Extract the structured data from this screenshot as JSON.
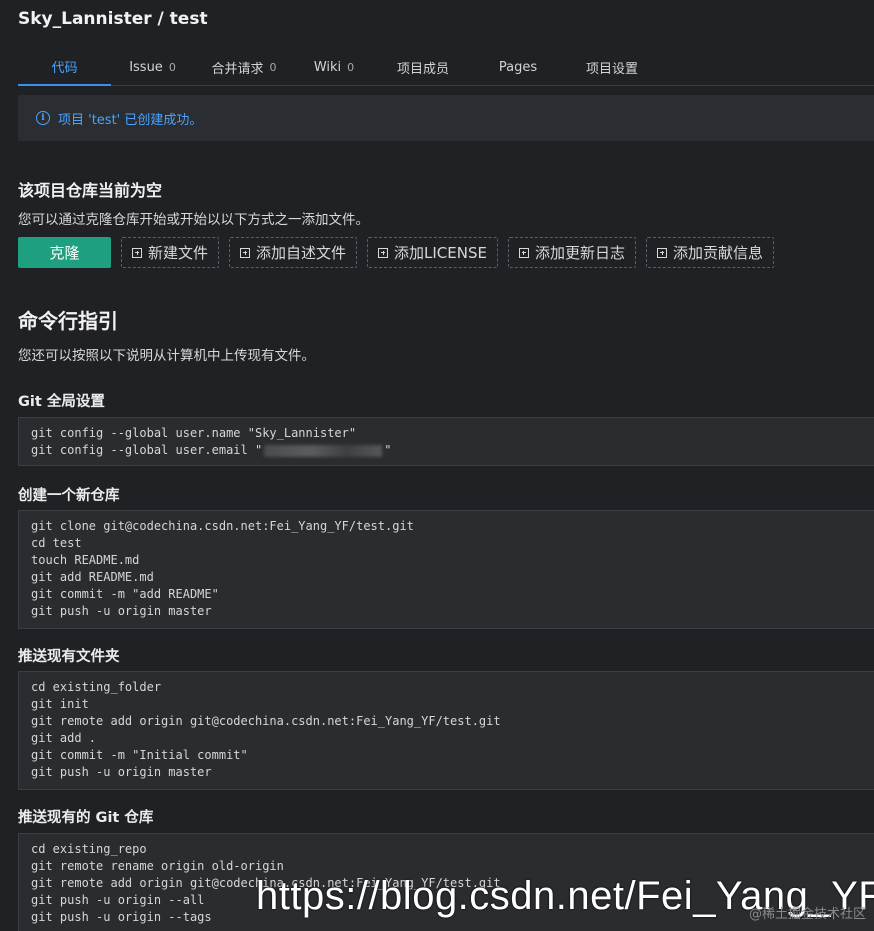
{
  "repo": {
    "title": "Sky_Lannister / test"
  },
  "tabs": [
    {
      "label": "代码",
      "count": ""
    },
    {
      "label": "Issue",
      "count": "0"
    },
    {
      "label": "合并请求",
      "count": "0"
    },
    {
      "label": "Wiki",
      "count": "0"
    },
    {
      "label": "项目成员",
      "count": ""
    },
    {
      "label": "Pages",
      "count": ""
    },
    {
      "label": "项目设置",
      "count": ""
    }
  ],
  "alert": {
    "icon": "info-icon",
    "text": "项目 'test' 已创建成功。",
    "color": "#4aa3ff"
  },
  "empty": {
    "heading": "该项目仓库当前为空",
    "description": "您可以通过克隆仓库开始或开始以以下方式之一添加文件。",
    "clone_label": "克隆",
    "actions": [
      "新建文件",
      "添加自述文件",
      "添加LICENSE",
      "添加更新日志",
      "添加贡献信息"
    ]
  },
  "cli": {
    "heading": "命令行指引",
    "description": "您还可以按照以下说明从计算机中上传现有文件。"
  },
  "sections": [
    {
      "title": "Git 全局设置",
      "lines": [
        "git config --global user.name \"Sky_Lannister\"",
        "git config --global user.email \""
      ]
    },
    {
      "title": "创建一个新仓库",
      "lines": [
        "git clone git@codechina.csdn.net:Fei_Yang_YF/test.git",
        "cd test",
        "touch README.md",
        "git add README.md",
        "git commit -m \"add README\"",
        "git push -u origin master"
      ]
    },
    {
      "title": "推送现有文件夹",
      "lines": [
        "cd existing_folder",
        "git init",
        "git remote add origin git@codechina.csdn.net:Fei_Yang_YF/test.git",
        "git add .",
        "git commit -m \"Initial commit\"",
        "git push -u origin master"
      ]
    },
    {
      "title": "推送现有的 Git 仓库",
      "lines": [
        "cd existing_repo",
        "git remote rename origin old-origin",
        "git remote add origin git@codechina.csdn.net:Fei_Yang_YF/test.git",
        "git push -u origin --all",
        "git push -u origin --tags"
      ]
    }
  ],
  "email_suffix": "\"",
  "watermark": "https://blog.csdn.net/Fei_Yang_YF",
  "watermark_small": "@稀土掘金技术社区",
  "colors": {
    "accent": "#3b8eea",
    "clone": "#1e9f7f",
    "background": "#1f2124"
  }
}
